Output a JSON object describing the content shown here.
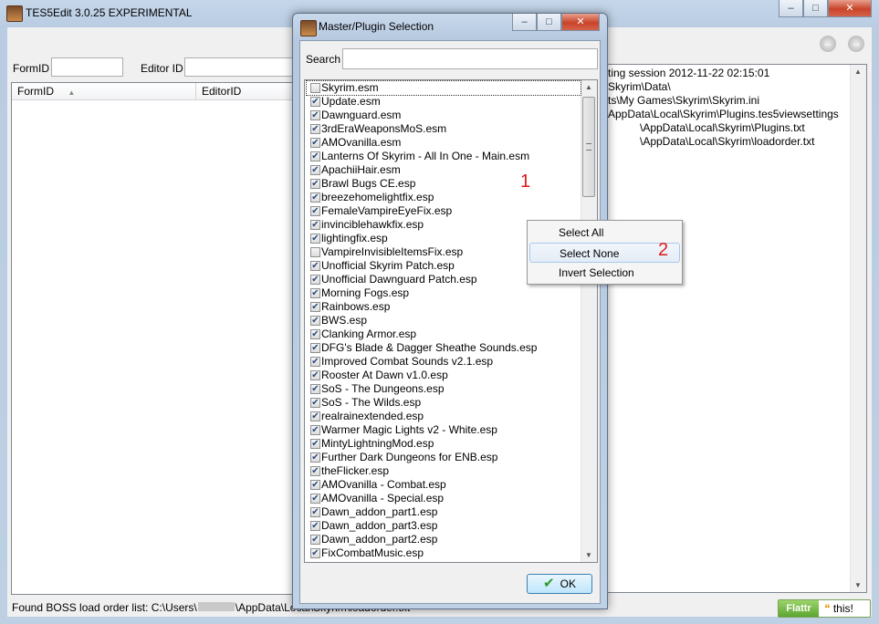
{
  "main": {
    "title": "TES5Edit 3.0.25 EXPERIMENTAL",
    "formid_label": "FormID",
    "editorid_label": "Editor ID",
    "col_formid": "FormID",
    "col_editorid": "EditorID",
    "messages": [
      "ting session 2012-11-22 02:15:01",
      "Skyrim\\Data\\",
      "ts\\My Games\\Skyrim\\Skyrim.ini",
      "AppData\\Local\\Skyrim\\Plugins.tes5viewsettings",
      "\\AppData\\Local\\Skyrim\\Plugins.txt",
      "\\AppData\\Local\\Skyrim\\loadorder.txt"
    ],
    "status": "Found BOSS load order list: C:\\Users\\",
    "status_tail": "\\AppData\\Local\\Skyrim\\loadorder.txt",
    "flattr_label": "Flattr",
    "flattr_this": "this!"
  },
  "dialog": {
    "title": "Master/Plugin Selection",
    "search_label": "Search",
    "search_value": "",
    "ok_label": "OK",
    "plugins": [
      {
        "name": "Skyrim.esm",
        "checked": false
      },
      {
        "name": "Update.esm",
        "checked": true
      },
      {
        "name": "Dawnguard.esm",
        "checked": true
      },
      {
        "name": "3rdEraWeaponsMoS.esm",
        "checked": true
      },
      {
        "name": "AMOvanilla.esm",
        "checked": true
      },
      {
        "name": "Lanterns Of Skyrim - All In One - Main.esm",
        "checked": true
      },
      {
        "name": "ApachiiHair.esm",
        "checked": true
      },
      {
        "name": "Brawl Bugs CE.esp",
        "checked": true
      },
      {
        "name": "breezehomelightfix.esp",
        "checked": true
      },
      {
        "name": "FemaleVampireEyeFix.esp",
        "checked": true
      },
      {
        "name": "invinciblehawkfix.esp",
        "checked": true
      },
      {
        "name": "lightingfix.esp",
        "checked": true
      },
      {
        "name": "VampireInvisibleItemsFix.esp",
        "checked": false
      },
      {
        "name": "Unofficial Skyrim Patch.esp",
        "checked": true
      },
      {
        "name": "Unofficial Dawnguard Patch.esp",
        "checked": true
      },
      {
        "name": "Morning Fogs.esp",
        "checked": true
      },
      {
        "name": "Rainbows.esp",
        "checked": true
      },
      {
        "name": "BWS.esp",
        "checked": true
      },
      {
        "name": "Clanking Armor.esp",
        "checked": true
      },
      {
        "name": "DFG's Blade & Dagger Sheathe Sounds.esp",
        "checked": true
      },
      {
        "name": "Improved Combat Sounds v2.1.esp",
        "checked": true
      },
      {
        "name": "Rooster At Dawn v1.0.esp",
        "checked": true
      },
      {
        "name": "SoS - The Dungeons.esp",
        "checked": true
      },
      {
        "name": "SoS - The Wilds.esp",
        "checked": true
      },
      {
        "name": "realrainextended.esp",
        "checked": true
      },
      {
        "name": "Warmer Magic Lights v2 - White.esp",
        "checked": true
      },
      {
        "name": "MintyLightningMod.esp",
        "checked": true
      },
      {
        "name": "Further Dark Dungeons for ENB.esp",
        "checked": true
      },
      {
        "name": "theFlicker.esp",
        "checked": true
      },
      {
        "name": "AMOvanilla - Combat.esp",
        "checked": true
      },
      {
        "name": "AMOvanilla - Special.esp",
        "checked": true
      },
      {
        "name": "Dawn_addon_part1.esp",
        "checked": true
      },
      {
        "name": "Dawn_addon_part3.esp",
        "checked": true
      },
      {
        "name": "Dawn_addon_part2.esp",
        "checked": true
      },
      {
        "name": "FixCombatMusic.esp",
        "checked": true
      }
    ]
  },
  "context_menu": {
    "items": [
      "Select All",
      "Select None",
      "Invert Selection"
    ],
    "highlighted": 1
  },
  "annotations": {
    "one": "1",
    "two": "2"
  }
}
